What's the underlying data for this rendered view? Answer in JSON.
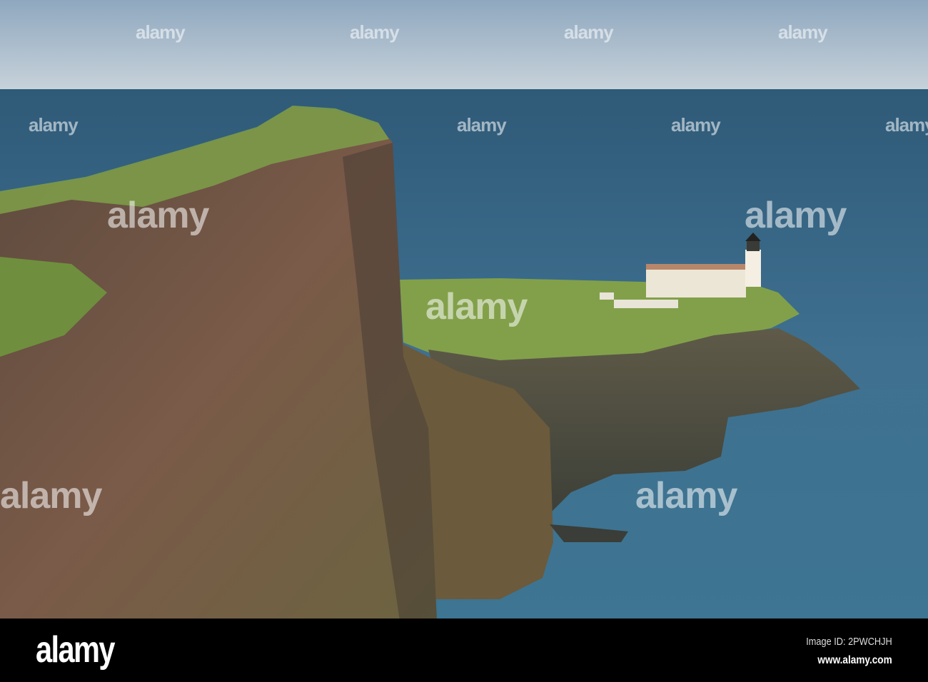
{
  "photo": {
    "subject": "Neist Point Lighthouse",
    "colors": {
      "sky_top": "#8fa8bf",
      "sky_horizon": "#c7d2da",
      "sea_far": "#3b6683",
      "sea_near": "#4f87a3",
      "grass": "#7f9a45",
      "rock": "#6a4a3c"
    }
  },
  "watermark": {
    "text": "alamy"
  },
  "footer": {
    "logo": "alamy",
    "image_id": "Image ID: 2PWCHJH",
    "website": "www.alamy.com"
  }
}
